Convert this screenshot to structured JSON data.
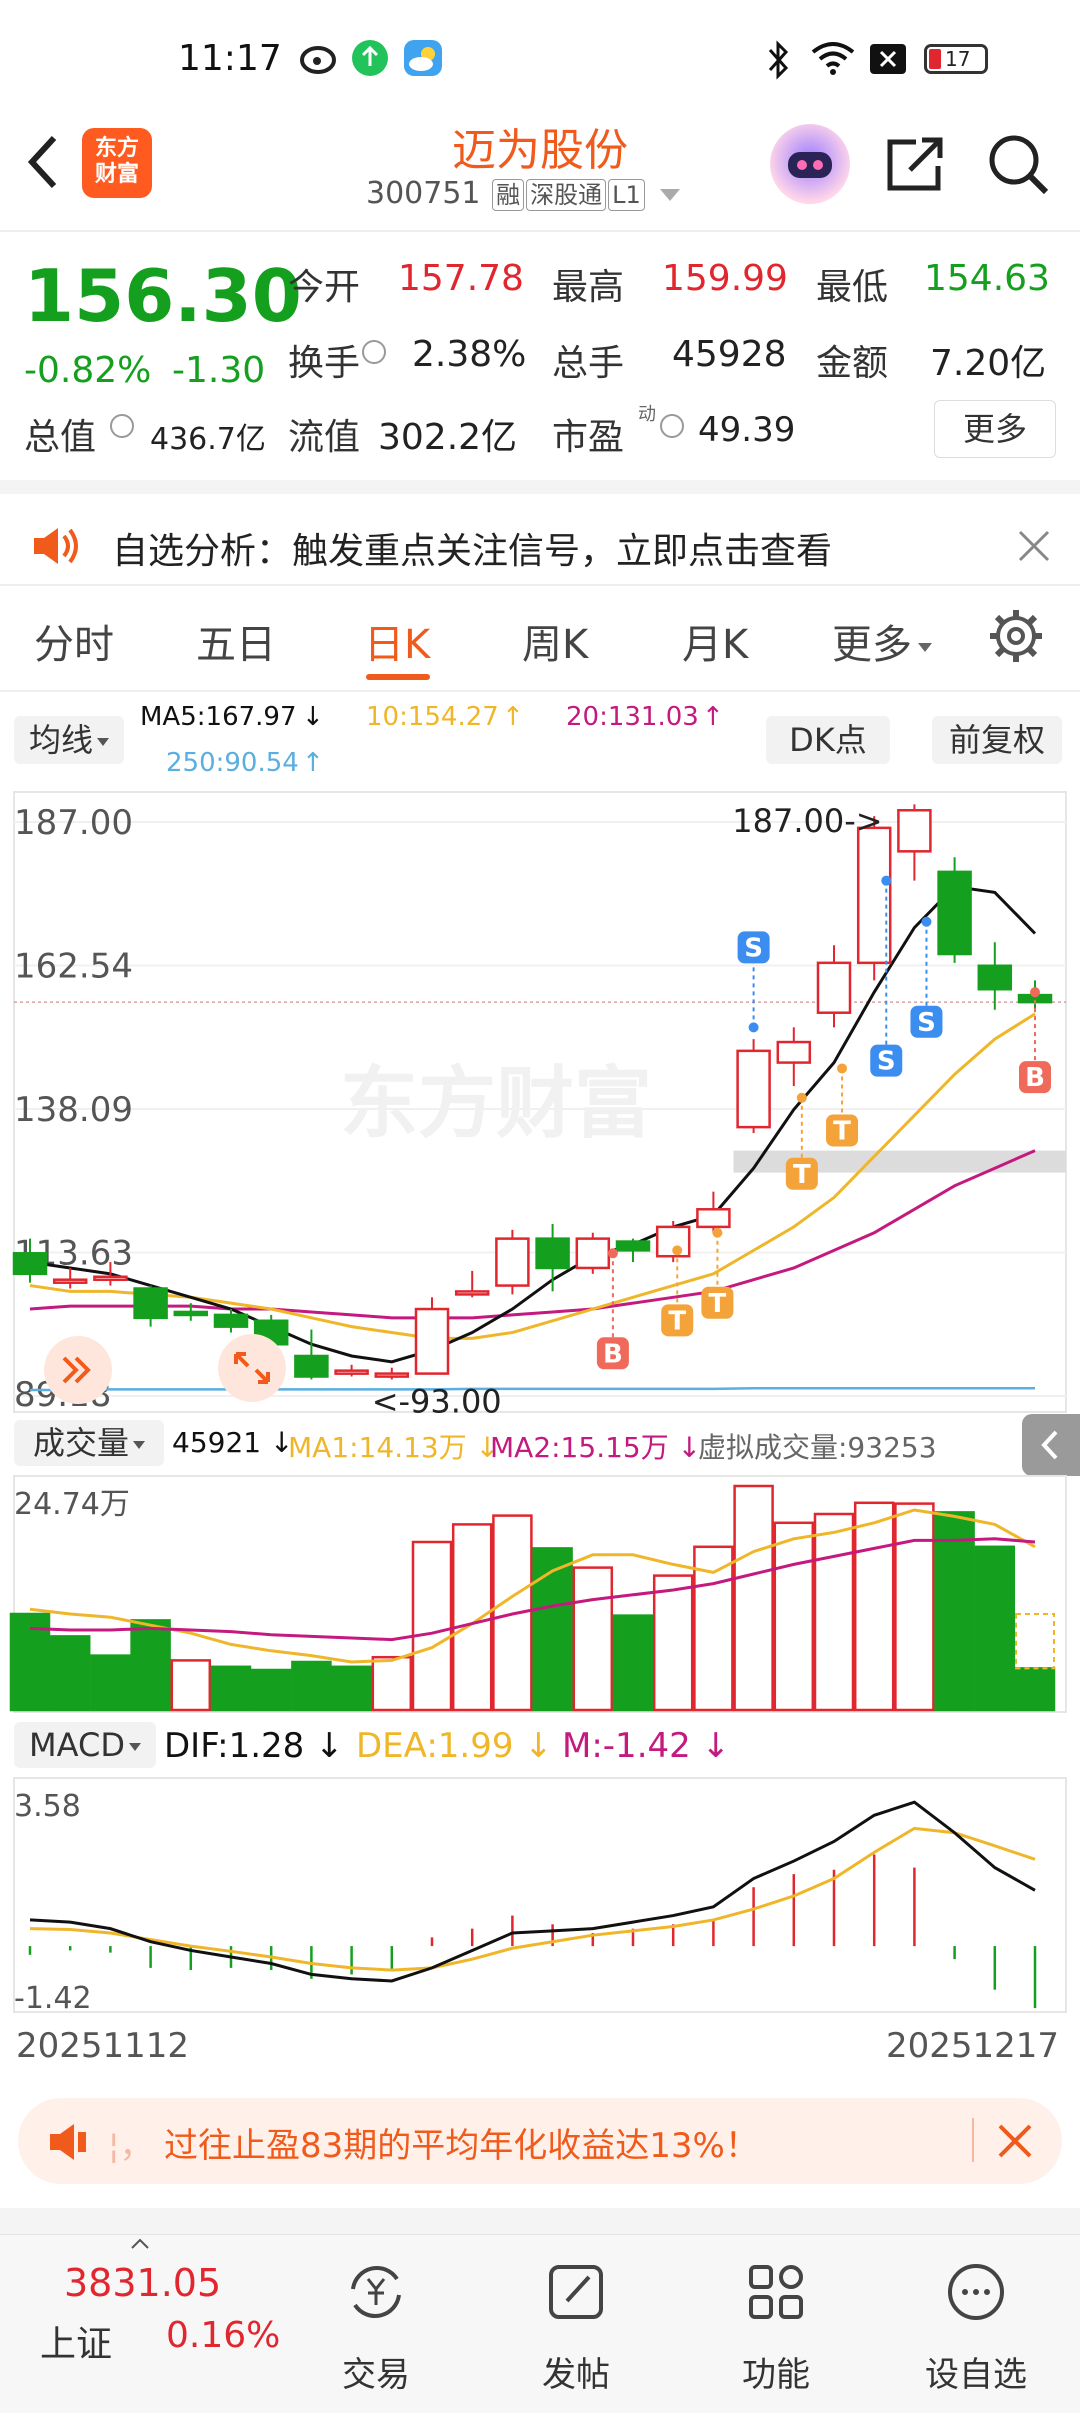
{
  "status_bar": {
    "time": "11:17",
    "battery": "17"
  },
  "header": {
    "stock_name": "迈为股份",
    "code": "300751",
    "tags": [
      "融",
      "深股通",
      "L1"
    ],
    "logo_text_line1": "东方",
    "logo_text_line2": "财富"
  },
  "quote": {
    "price": "156.30",
    "change_pct": "-0.82%",
    "change": "-1.30",
    "open_label": "今开",
    "open": "157.78",
    "high_label": "最高",
    "high": "159.99",
    "low_label": "最低",
    "low": "154.63",
    "turnover_label": "换手",
    "turnover": "2.38%",
    "volume_label": "总手",
    "volume": "45928",
    "amount_label": "金额",
    "amount": "7.20亿",
    "mcap_label": "总值",
    "mcap": "436.7亿",
    "float_label": "流值",
    "float": "302.2亿",
    "pe_label": "市盈",
    "pe_sup": "动",
    "pe": "49.39",
    "more_label": "更多"
  },
  "banner": {
    "text": "自选分析：触发重点关注信号，立即点击查看"
  },
  "tabs": [
    "分时",
    "五日",
    "日K",
    "周K",
    "月K",
    "更多"
  ],
  "active_tab": "日K",
  "chart_header": {
    "ma_selector": "均线",
    "ma5": "MA5:167.97",
    "ma10": "10:154.27",
    "ma20": "20:131.03",
    "ma250": "250:90.54",
    "dk_label": "DK点",
    "fq_label": "前复权"
  },
  "chart_data": [
    {
      "type": "candlestick",
      "y_ticks": [
        "187.00",
        "162.54",
        "138.09",
        "113.63",
        "89.18"
      ],
      "ylim": [
        89.18,
        187.0
      ],
      "annotations": [
        "187.00->",
        "<-93.00"
      ],
      "signals": [
        "S",
        "S",
        "S",
        "S",
        "B",
        "B",
        "T",
        "T",
        "T",
        "T",
        "T"
      ],
      "watermark": "东方财富",
      "candles": [
        {
          "o": 113.5,
          "c": 110.0,
          "h": 116.0,
          "l": 108.5
        },
        {
          "o": 109.0,
          "c": 109.0,
          "h": 111.0,
          "l": 107.5
        },
        {
          "o": 109.5,
          "c": 109.5,
          "h": 112.0,
          "l": 108.0
        },
        {
          "o": 107.5,
          "c": 102.5,
          "h": 108.0,
          "l": 101.0
        },
        {
          "o": 103.5,
          "c": 103.0,
          "h": 105.0,
          "l": 102.0
        },
        {
          "o": 103.0,
          "c": 101.0,
          "h": 104.0,
          "l": 100.0
        },
        {
          "o": 102.0,
          "c": 98.0,
          "h": 103.0,
          "l": 97.5
        },
        {
          "o": 96.0,
          "c": 92.5,
          "h": 100.5,
          "l": 92.0
        },
        {
          "o": 93.5,
          "c": 93.5,
          "h": 94.5,
          "l": 92.5
        },
        {
          "o": 93.0,
          "c": 93.0,
          "h": 94.0,
          "l": 92.0
        },
        {
          "o": 93.0,
          "c": 104.0,
          "h": 106.0,
          "l": 93.0
        },
        {
          "o": 107.0,
          "c": 107.0,
          "h": 110.5,
          "l": 106.0
        },
        {
          "o": 108.0,
          "c": 116.0,
          "h": 117.5,
          "l": 106.5
        },
        {
          "o": 116.0,
          "c": 111.0,
          "h": 118.5,
          "l": 107.0
        },
        {
          "o": 111.0,
          "c": 116.0,
          "h": 117.0,
          "l": 110.0
        },
        {
          "o": 115.5,
          "c": 114.0,
          "h": 116.0,
          "l": 112.0
        },
        {
          "o": 113.0,
          "c": 118.0,
          "h": 119.0,
          "l": 112.0
        },
        {
          "o": 118.0,
          "c": 121.0,
          "h": 124.0,
          "l": 117.0
        },
        {
          "o": 135.0,
          "c": 148.0,
          "h": 150.0,
          "l": 134.0
        },
        {
          "o": 146.0,
          "c": 149.5,
          "h": 152.0,
          "l": 142.0
        },
        {
          "o": 154.5,
          "c": 163.0,
          "h": 166.0,
          "l": 152.0
        },
        {
          "o": 163.0,
          "c": 186.0,
          "h": 188.0,
          "l": 160.0
        },
        {
          "o": 182.0,
          "c": 189.0,
          "h": 190.0,
          "l": 177.0
        },
        {
          "o": 178.5,
          "c": 164.5,
          "h": 181.0,
          "l": 163.0
        },
        {
          "o": 162.5,
          "c": 158.5,
          "h": 166.5,
          "l": 155.0
        },
        {
          "o": 157.5,
          "c": 156.3,
          "h": 160.0,
          "l": 154.6
        }
      ],
      "ma5_line": [
        112,
        111,
        110,
        108,
        106,
        104,
        101,
        98,
        96,
        95,
        97,
        100,
        104,
        109,
        113,
        115,
        118,
        120,
        128,
        138,
        146,
        158,
        169,
        176,
        175,
        168
      ],
      "ma10_line": [
        108,
        107,
        107,
        106.5,
        106,
        105,
        104,
        102.5,
        101,
        100,
        99,
        99,
        100,
        102,
        104,
        106,
        108,
        110,
        114,
        118,
        123,
        130,
        137,
        144,
        150,
        154.3
      ],
      "ma20_line": [
        104,
        104.5,
        104.5,
        104.5,
        104.5,
        104,
        104,
        103.5,
        103,
        102.5,
        102.5,
        102.5,
        103,
        103.5,
        104,
        105,
        106,
        107,
        109,
        111,
        114,
        117,
        121,
        125,
        128,
        131
      ],
      "ma250_line": [
        90.2,
        90.2,
        90.3,
        90.3,
        90.3,
        90.3,
        90.3,
        90.3,
        90.3,
        90.3,
        90.3,
        90.4,
        90.4,
        90.4,
        90.4,
        90.4,
        90.4,
        90.4,
        90.5,
        90.5,
        90.5,
        90.5,
        90.5,
        90.5,
        90.5,
        90.5
      ]
    },
    {
      "type": "bar",
      "name": "成交量",
      "labels": {
        "selector": "成交量",
        "vol": "45921",
        "ma1": "MA1:14.13万",
        "ma2": "MA2:15.15万",
        "virtual": "虚拟成交量:93253"
      },
      "y_tick": "24.74万",
      "ylim": [
        0,
        24.74
      ],
      "values": [
        12,
        9.2,
        6.8,
        11.2,
        6.2,
        5.4,
        5.0,
        6.0,
        5.4,
        6.6,
        21.0,
        23.2,
        24.3,
        20.2,
        17.8,
        11.8,
        16.8,
        20.4,
        28.0,
        23.4,
        24.5,
        25.9,
        25.8,
        24.7,
        20.4,
        5.2
      ],
      "up": [
        false,
        false,
        false,
        false,
        true,
        false,
        false,
        false,
        false,
        true,
        true,
        true,
        true,
        false,
        true,
        false,
        true,
        true,
        true,
        true,
        true,
        true,
        true,
        false,
        false,
        false
      ],
      "ma1_line": [
        12.6,
        12.0,
        11.6,
        10.6,
        9.6,
        8.2,
        7.4,
        6.8,
        6.0,
        6.2,
        7.8,
        10.8,
        14.2,
        17.4,
        19.4,
        19.4,
        18.2,
        17.2,
        19.8,
        21.4,
        22.2,
        23.4,
        25.0,
        24.2,
        23.2,
        20.4
      ],
      "ma2_line": [
        10.2,
        10.0,
        10.0,
        10.2,
        10.0,
        9.8,
        9.4,
        9.2,
        9.0,
        8.8,
        9.6,
        10.8,
        12.0,
        13.0,
        13.8,
        14.4,
        15.0,
        15.8,
        17.0,
        18.2,
        19.2,
        20.2,
        21.2,
        21.2,
        21.4,
        21.0
      ]
    },
    {
      "type": "macd",
      "labels": {
        "selector": "MACD",
        "dif": "DIF:1.28",
        "dea": "DEA:1.99",
        "m": "M:-1.42"
      },
      "y_ticks": [
        "3.58",
        "-1.42"
      ],
      "ylim": [
        -1.42,
        3.58
      ],
      "dif": [
        0.6,
        0.55,
        0.4,
        0.1,
        -0.1,
        -0.25,
        -0.4,
        -0.65,
        -0.75,
        -0.8,
        -0.5,
        -0.1,
        0.3,
        0.35,
        0.4,
        0.55,
        0.7,
        0.9,
        1.55,
        1.95,
        2.4,
        3.0,
        3.3,
        2.6,
        1.8,
        1.28
      ],
      "dea": [
        0.4,
        0.38,
        0.3,
        0.15,
        0.0,
        -0.12,
        -0.25,
        -0.4,
        -0.5,
        -0.55,
        -0.5,
        -0.3,
        -0.05,
        0.1,
        0.25,
        0.35,
        0.45,
        0.6,
        0.85,
        1.15,
        1.55,
        2.15,
        2.7,
        2.6,
        2.3,
        1.99
      ],
      "macd": [
        -0.2,
        -0.1,
        -0.15,
        -0.5,
        -0.55,
        -0.5,
        -0.55,
        -0.75,
        -0.65,
        -0.55,
        0.2,
        0.4,
        0.7,
        0.5,
        0.3,
        0.4,
        0.5,
        0.6,
        1.35,
        1.65,
        1.75,
        2.1,
        1.8,
        -0.3,
        -1.0,
        -1.42
      ]
    }
  ],
  "date_start": "20251112",
  "date_end": "20251217",
  "ad_bar": {
    "text": "过往止盈83期的平均年化收益达13%！",
    "prefix": "¦，"
  },
  "bottom_nav": {
    "index_value": "3831.05",
    "index_name": "上证",
    "index_change": "0.16%",
    "items": [
      "交易",
      "发帖",
      "功能",
      "设自选"
    ]
  },
  "colors": {
    "up": "#e0262e",
    "down": "#14a01e",
    "accent": "#f05a1a",
    "ma5": "#111111",
    "ma10": "#efb62a",
    "ma20": "#c4197e",
    "ma250": "#5aaee0"
  }
}
